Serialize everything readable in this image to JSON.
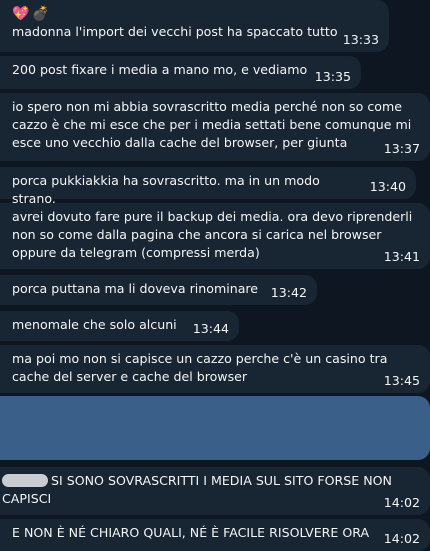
{
  "messages": [
    {
      "emojis": [
        "💖",
        "💣"
      ],
      "text": "madonna l'import dei vecchi post ha spaccato tutto",
      "time": "13:33"
    },
    {
      "text": "200 post fixare i media a mano mo, e vediamo",
      "time": "13:35"
    },
    {
      "text": "io spero non mi abbia sovrascritto media perché non so come cazzo è che mi esce che per i media settati bene comunque mi esce uno vecchio dalla cache del browser, per giunta",
      "time": "13:37"
    },
    {
      "text": "porca pukkiakkia ha sovrascritto. ma in un modo strano.",
      "time": "13:40"
    },
    {
      "text": "avrei dovuto fare pure il backup dei media. ora devo riprenderli non so come dalla pagina che ancora si carica nel browser oppure da telegram (compressi merda)",
      "time": "13:41"
    },
    {
      "text": "porca puttana ma li doveva rinominare",
      "time": "13:42"
    },
    {
      "text": "menomale che solo alcuni",
      "time": "13:44"
    },
    {
      "text": "ma poi mo non si capisce un cazzo perche c'è un casino tra cache del server e cache del browser",
      "time": "13:45"
    },
    {
      "text": "SI SONO SOVRASCRITTI I MEDIA SUL SITO FORSE NON CAPISCI",
      "time": "14:02"
    },
    {
      "text": "E NON È NÉ CHIARO QUALI, NÉ È FACILE RISOLVERE ORA",
      "time": "14:02"
    }
  ]
}
